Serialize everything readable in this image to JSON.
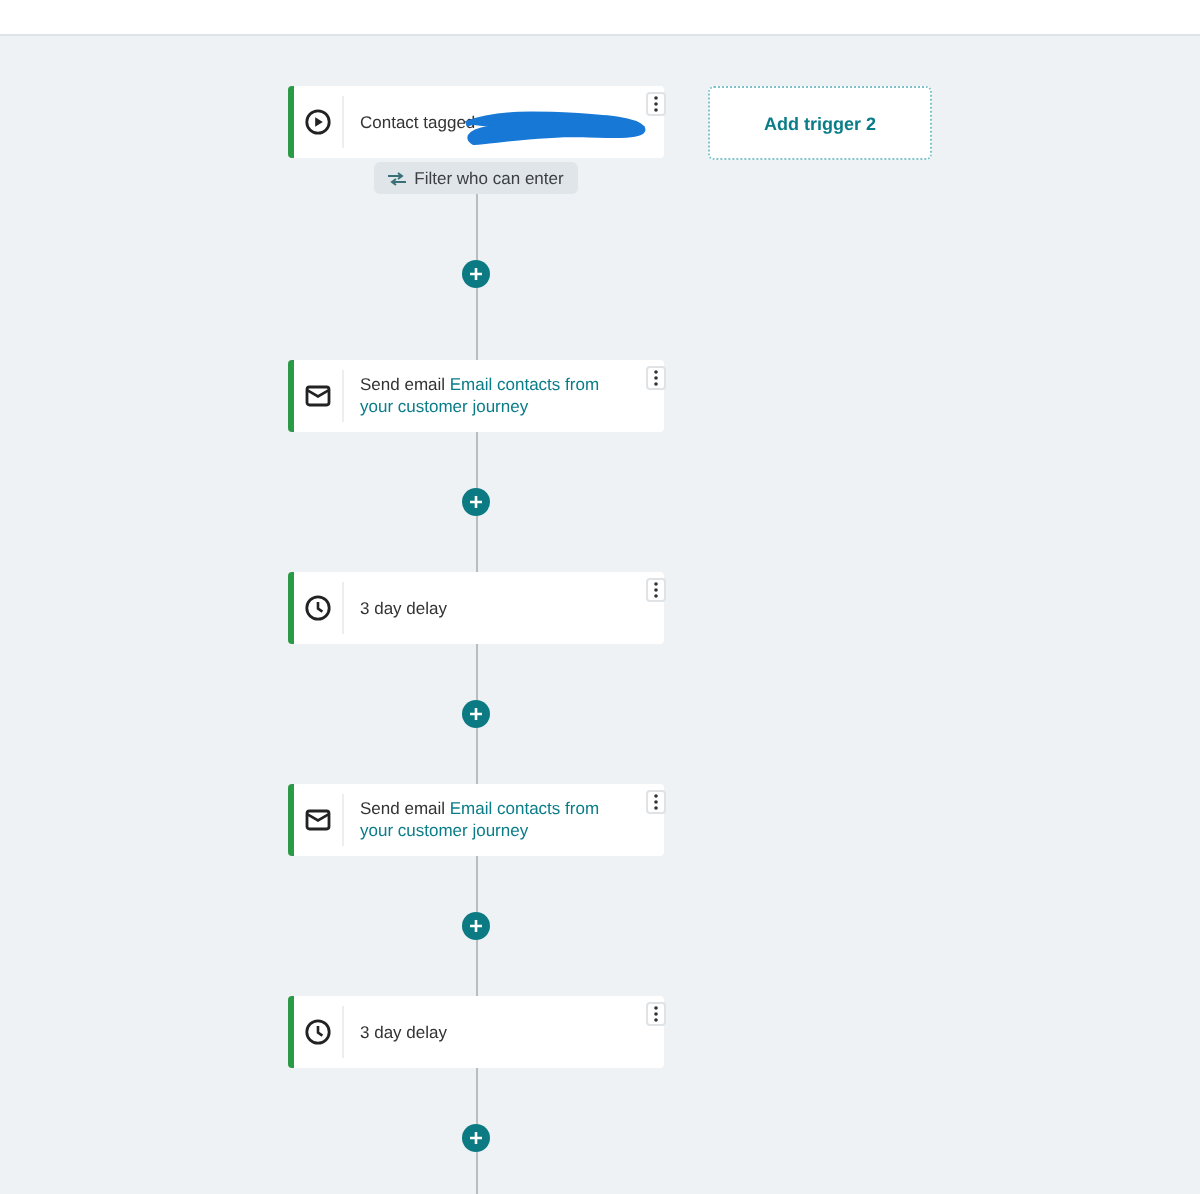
{
  "trigger": {
    "kind": "trigger",
    "label": "Contact tagged",
    "redacted": true,
    "filter_button": "Filter who can enter"
  },
  "add_trigger": {
    "label": "Add trigger 2"
  },
  "steps": [
    {
      "kind": "email",
      "label": "Send email",
      "link": "Email contacts from your customer journey"
    },
    {
      "kind": "delay",
      "label": "3 day delay"
    },
    {
      "kind": "email",
      "label": "Send email",
      "link": "Email contacts from your customer journey"
    },
    {
      "kind": "delay",
      "label": "3 day delay"
    }
  ]
}
